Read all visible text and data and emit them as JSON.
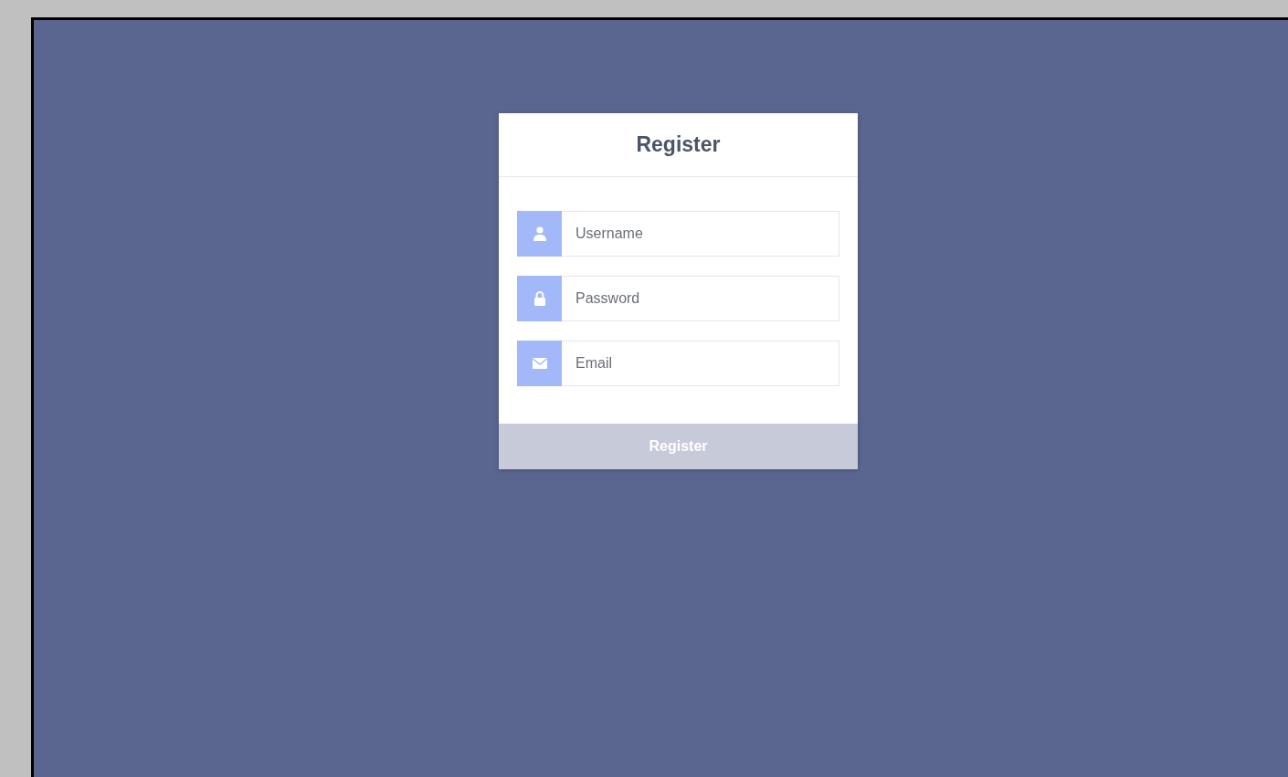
{
  "form": {
    "title": "Register",
    "fields": [
      {
        "kind": "user",
        "placeholder": "Username"
      },
      {
        "kind": "lock",
        "placeholder": "Password"
      },
      {
        "kind": "email",
        "placeholder": "Email"
      }
    ],
    "submit": {
      "label": "Register",
      "disabled": true
    }
  }
}
